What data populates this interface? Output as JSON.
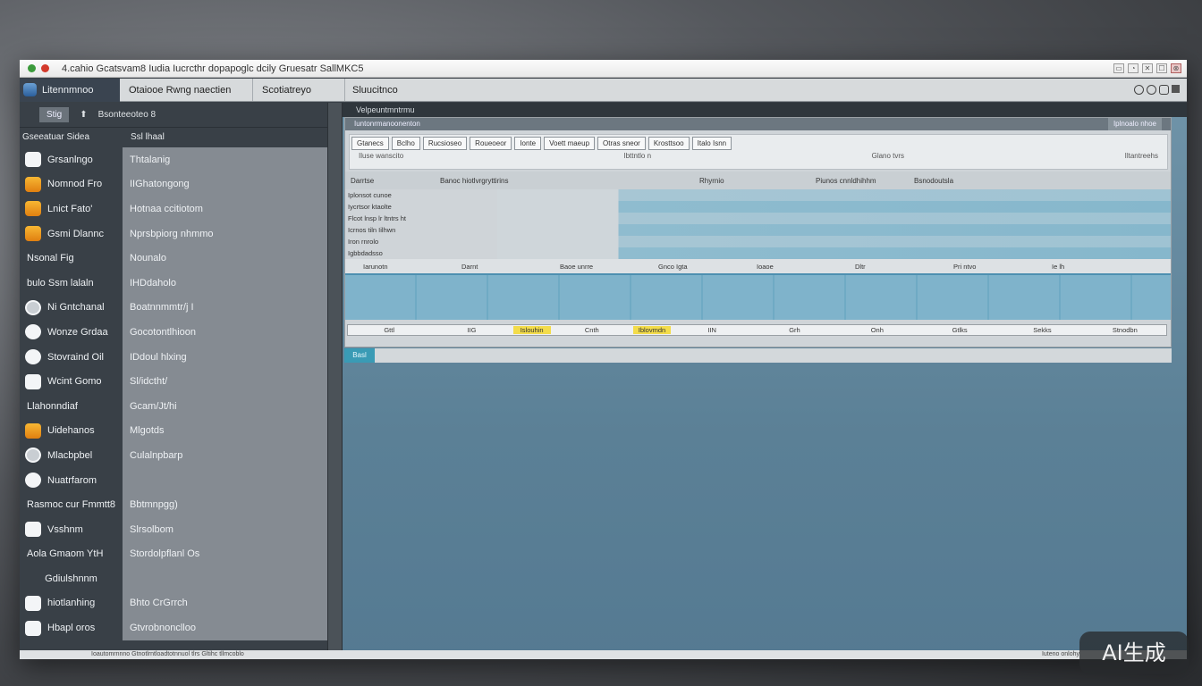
{
  "titlebar": {
    "title": "4.cahio Gcatsvam8 Iudia Iucrcthr dopapoglc dcily Gruesatr SallMKC5",
    "buttons": [
      "▭",
      "◔",
      "✕",
      "☐",
      "⊗"
    ]
  },
  "header": {
    "logo": "Litennmnoo",
    "tabs": [
      "Otaiooe Rwng naectien",
      "Scotiatreyo",
      "Sluucitnco"
    ]
  },
  "sidebar": {
    "toolbar": {
      "btn": "Stig",
      "label": "Bsonteeoteo 8"
    },
    "header": {
      "col1": "Gseeatuar Sidea",
      "col2": "Ssl lhaal"
    },
    "items": [
      {
        "name": "Grsanlngo",
        "value": "Thtalanig",
        "icon": "white"
      },
      {
        "name": "Nomnod Fro",
        "value": "IIGhatongong",
        "icon": "orange"
      },
      {
        "name": "Lnict Fato'",
        "value": "Hotnaa ccitiotom",
        "icon": "orange"
      },
      {
        "name": "Gsmi Dlannc",
        "value": "Nprsbpiorg nhmmo",
        "icon": "orange"
      },
      {
        "name": "Nsonal Fig",
        "value": "Nounalo",
        "icon": ""
      },
      {
        "name": "bulo Ssm lalaln",
        "value": "IHDdaholo",
        "icon": ""
      },
      {
        "name": "Ni Gntchanal",
        "value": "Boatnnmmtr/j I",
        "icon": "ring"
      },
      {
        "name": "Wonze Grdaa",
        "value": "Gocotontlhioon",
        "icon": "round"
      },
      {
        "name": "Stovraind Oil",
        "value": "IDdoul hlxing",
        "icon": "round"
      },
      {
        "name": "Wcint Gomo",
        "value": "Sl/idctht/",
        "icon": "white"
      },
      {
        "name": "Llahonndiaf",
        "value": "Gcam/Jt/hi",
        "icon": ""
      },
      {
        "name": "Uidehanos",
        "value": "Mlgotds",
        "icon": "orange"
      },
      {
        "name": "Mlacbpbel",
        "value": "Culalnpbarp",
        "icon": "ring"
      },
      {
        "name": "Nuatrfarom",
        "value": "",
        "icon": "round"
      },
      {
        "name": "Rasmoc cur Fmmtt8",
        "value": "Bbtmnpgg)",
        "icon": ""
      },
      {
        "name": "Vsshnm",
        "value": "Slrsolbom",
        "icon": "white"
      },
      {
        "name": "Aola Gmaom YtH",
        "value": "Stordolpflanl Os",
        "icon": ""
      },
      {
        "name": "Gdiulshnnm",
        "value": "",
        "icon": ""
      },
      {
        "name": "hiotlanhing",
        "value": "Bhto CrGrrch",
        "icon": "white"
      },
      {
        "name": "Hbapl oros",
        "value": "Gtvrobnonclloo",
        "icon": "white"
      }
    ]
  },
  "main": {
    "topbar": "Velpeuntmntrmu",
    "panel": {
      "bar_left": "Iuntonrmanoonenton",
      "bar_right": "Iplnoalo nhoe",
      "filters": [
        "Gtanecs",
        "Bclho",
        "Rucsioseo",
        "Roueoeor",
        "Ionte",
        "Voett maeup",
        "Otras sneor",
        "Krosttsoo",
        "Italo Isnn"
      ],
      "filter_sub": [
        "Iluse wanscito",
        "lbttntlo n",
        "Glano tvrs",
        "Iltantreehs"
      ],
      "grid_head": [
        "Darrtse",
        "Banoc hiotlvrgryttirins",
        "Rhyrnio",
        "Piunos cnnldhihhm",
        "Bsnodoutsla"
      ],
      "grid_rows": [
        "Iplonsot cunoe",
        "Iycrtsor ktaolte",
        "Flcot lnsp lr ltntrs ht",
        "Icrnos tiln Iilhwn",
        "Iron rnrolo",
        "Igbbdadsso"
      ],
      "sub_head": [
        "Iarunotn",
        "Darnt",
        "Baoe unrre",
        "Gnco Igta",
        "Ioaoe",
        "Dltr",
        "Pri ntvo",
        "Ie lh"
      ],
      "footer": [
        "Gttl",
        "IIG",
        "Islouhin",
        "Cnth",
        "Iblovmdn",
        "IIN",
        "Grh",
        "Onh",
        "Gtlks",
        "Sekks",
        "Stnodbn"
      ]
    },
    "status_tag": "Basl"
  },
  "statusbar": {
    "left": "Ioautomrnnno Gtnotlrntloadtotnnuol tlrs Gltihc tllmcoblo",
    "right": "Iuteno onlohy"
  },
  "badge": "AI生成"
}
